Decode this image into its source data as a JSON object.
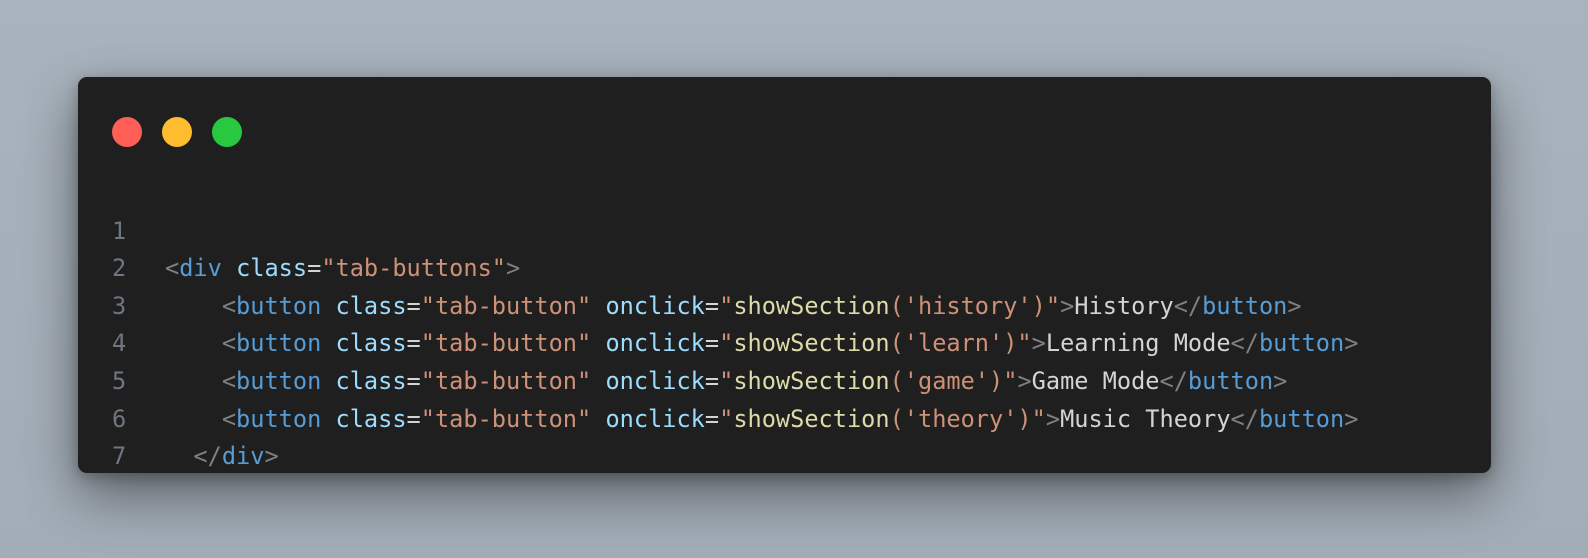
{
  "window": {
    "buttons": [
      "close",
      "minimize",
      "maximize"
    ],
    "colors": {
      "close": "#ff5f57",
      "minimize": "#febc2e",
      "maximize": "#28c840"
    }
  },
  "code": {
    "line_numbers": [
      "1",
      "2",
      "3",
      "4",
      "5",
      "6",
      "7"
    ],
    "lines": [
      {
        "indent": "",
        "tokens": [
          "<",
          "div",
          " ",
          "class",
          "=",
          "\"tab-buttons\"",
          ">"
        ]
      },
      {
        "indent": "    ",
        "tokens": [
          "<",
          "button",
          " ",
          "class",
          "=",
          "\"tab-button\"",
          " ",
          "onclick",
          "=",
          "\"",
          "showSection",
          "('history')",
          "\"",
          ">",
          "History",
          "</",
          "button",
          ">"
        ]
      },
      {
        "indent": "    ",
        "tokens": [
          "<",
          "button",
          " ",
          "class",
          "=",
          "\"tab-button\"",
          " ",
          "onclick",
          "=",
          "\"",
          "showSection",
          "('learn')",
          "\"",
          ">",
          "Learning Mode",
          "</",
          "button",
          ">"
        ]
      },
      {
        "indent": "    ",
        "tokens": [
          "<",
          "button",
          " ",
          "class",
          "=",
          "\"tab-button\"",
          " ",
          "onclick",
          "=",
          "\"",
          "showSection",
          "('game')",
          "\"",
          ">",
          "Game Mode",
          "</",
          "button",
          ">"
        ]
      },
      {
        "indent": "    ",
        "tokens": [
          "<",
          "button",
          " ",
          "class",
          "=",
          "\"tab-button\"",
          " ",
          "onclick",
          "=",
          "\"",
          "showSection",
          "('theory')",
          "\"",
          ">",
          "Music Theory",
          "</",
          "button",
          ">"
        ]
      },
      {
        "indent": "  ",
        "tokens": [
          "</",
          "div",
          ">"
        ]
      },
      {
        "indent": "",
        "tokens": []
      }
    ]
  }
}
